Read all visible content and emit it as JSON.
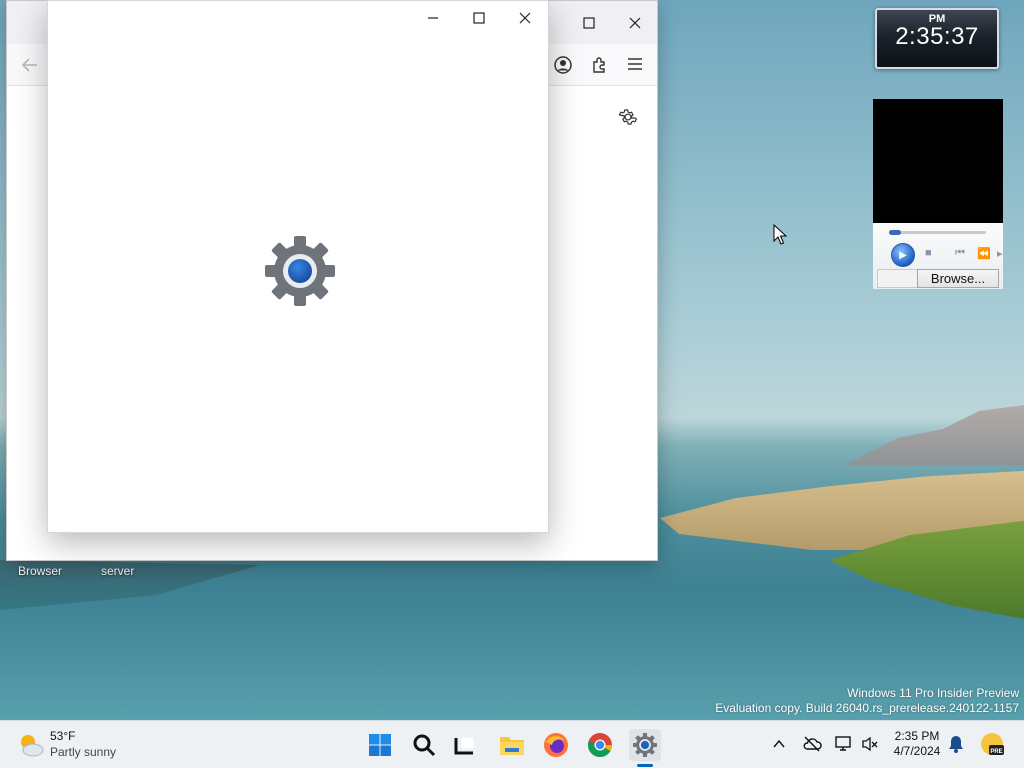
{
  "desktop": {
    "icon_labels": [
      "Browser",
      "server"
    ],
    "watermark_line1": "Windows 11 Pro Insider Preview",
    "watermark_line2": "Evaluation copy. Build 26040.rs_prerelease.240122-1157"
  },
  "clock_gadget": {
    "ampm": "PM",
    "time": "2:35:37"
  },
  "media_gadget": {
    "browse_label": "Browse...",
    "progress_fraction": 0.12
  },
  "taskbar": {
    "weather": {
      "temp": "53°F",
      "description": "Partly sunny"
    },
    "apps": [
      "start-icon",
      "search-icon",
      "task-view-icon",
      "file-explorer-icon",
      "firefox-icon",
      "chrome-icon",
      "settings-icon"
    ],
    "tray": {
      "time": "2:35 PM",
      "date": "4/7/2024"
    }
  },
  "colors": {
    "accent": "#0067c0",
    "settings_blue": "#1e63bd"
  }
}
